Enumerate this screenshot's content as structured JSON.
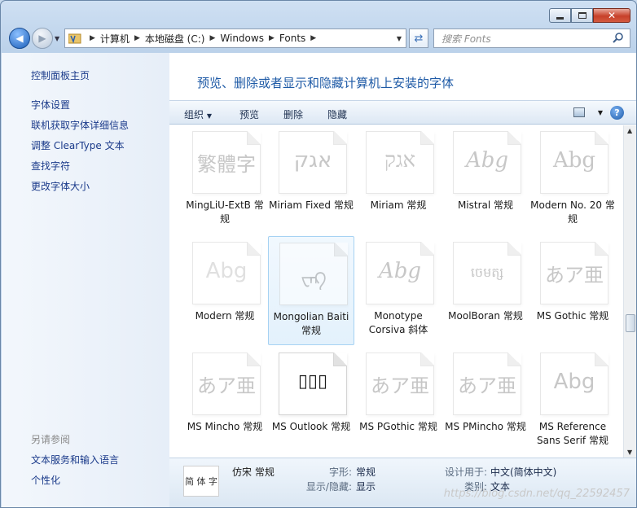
{
  "window": {
    "caption_buttons": {
      "minimize_icon": "minimize-icon",
      "maximize_icon": "maximize-icon",
      "close_icon": "close-icon"
    }
  },
  "address_bar": {
    "breadcrumb": [
      "计算机",
      "本地磁盘 (C:)",
      "Windows",
      "Fonts"
    ]
  },
  "search": {
    "placeholder": "搜索 Fonts"
  },
  "sidebar": {
    "home": "控制面板主页",
    "links": [
      "字体设置",
      "联机获取字体详细信息",
      "调整 ClearType 文本",
      "查找字符",
      "更改字体大小"
    ],
    "see_also_heading": "另请参阅",
    "see_also": [
      "文本服务和输入语言",
      "个性化"
    ]
  },
  "main": {
    "heading": "预览、删除或者显示和隐藏计算机上安装的字体"
  },
  "toolbar": {
    "organize": "组织",
    "preview": "预览",
    "delete": "删除",
    "hide": "隐藏"
  },
  "fonts": [
    {
      "name": "MingLiU-ExtB 常规",
      "glyph": "繁體字"
    },
    {
      "name": "Miriam Fixed 常规",
      "glyph": "אגק"
    },
    {
      "name": "Miriam 常规",
      "glyph": "אגק"
    },
    {
      "name": "Mistral 常规",
      "glyph": "Abg"
    },
    {
      "name": "Modern No. 20 常规",
      "glyph": "Abg"
    },
    {
      "name": "Modern 常规",
      "glyph": "Abg"
    },
    {
      "name": "Mongolian Baiti 常规",
      "glyph": "ᠸᠨᠺ"
    },
    {
      "name": "Monotype Corsiva 斜体",
      "glyph": "Abg"
    },
    {
      "name": "MoolBoran 常规",
      "glyph": "ចេមត្ស"
    },
    {
      "name": "MS Gothic 常规",
      "glyph": "あア亜"
    },
    {
      "name": "MS Mincho 常规",
      "glyph": "あア亜"
    },
    {
      "name": "MS Outlook 常规",
      "glyph": "▯▯▯"
    },
    {
      "name": "MS PGothic 常规",
      "glyph": "あア亜"
    },
    {
      "name": "MS PMincho 常规",
      "glyph": "あア亜"
    },
    {
      "name": "MS Reference Sans Serif 常规",
      "glyph": "Abg"
    }
  ],
  "details": {
    "preview_text": "简 体 字",
    "font_name": "仿宋 常规",
    "style_label": "字形:",
    "style_value": "常规",
    "showhide_label": "显示/隐藏:",
    "showhide_value": "显示",
    "designed_for_label": "设计用于:",
    "designed_for_value": "中文(简体中文)",
    "category_label": "类别:",
    "category_value": "文本"
  },
  "watermark": "https://blog.csdn.net/qq_22592457"
}
